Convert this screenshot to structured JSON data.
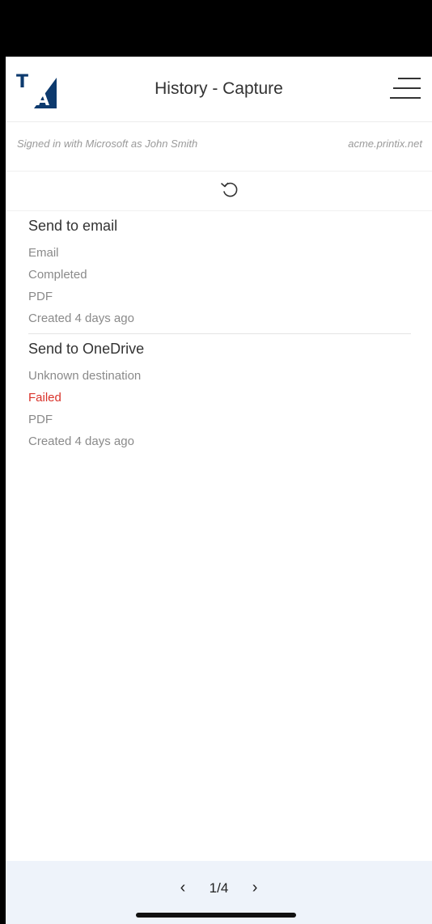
{
  "header": {
    "logo_text": "TA",
    "title": "History - Capture",
    "menu_icon": "menu-icon"
  },
  "account": {
    "signed_in": "Signed in with Microsoft as John Smith",
    "domain": "acme.printix.net"
  },
  "refresh_icon": "refresh-icon",
  "entries": [
    {
      "title": "Send to email",
      "destination": "Email",
      "status": "Completed",
      "format": "PDF",
      "created": "Created 4 days ago"
    },
    {
      "title": "Send to OneDrive",
      "destination": "Unknown destination",
      "status": "Failed",
      "format": "PDF",
      "created": "Created 4 days ago"
    }
  ],
  "pagination": {
    "prev": "‹",
    "page": "1/4",
    "next": "›"
  },
  "colors": {
    "failed": "#d9322a",
    "logo_blue": "#0d3a6e",
    "footer_bg": "#eef3fa"
  }
}
